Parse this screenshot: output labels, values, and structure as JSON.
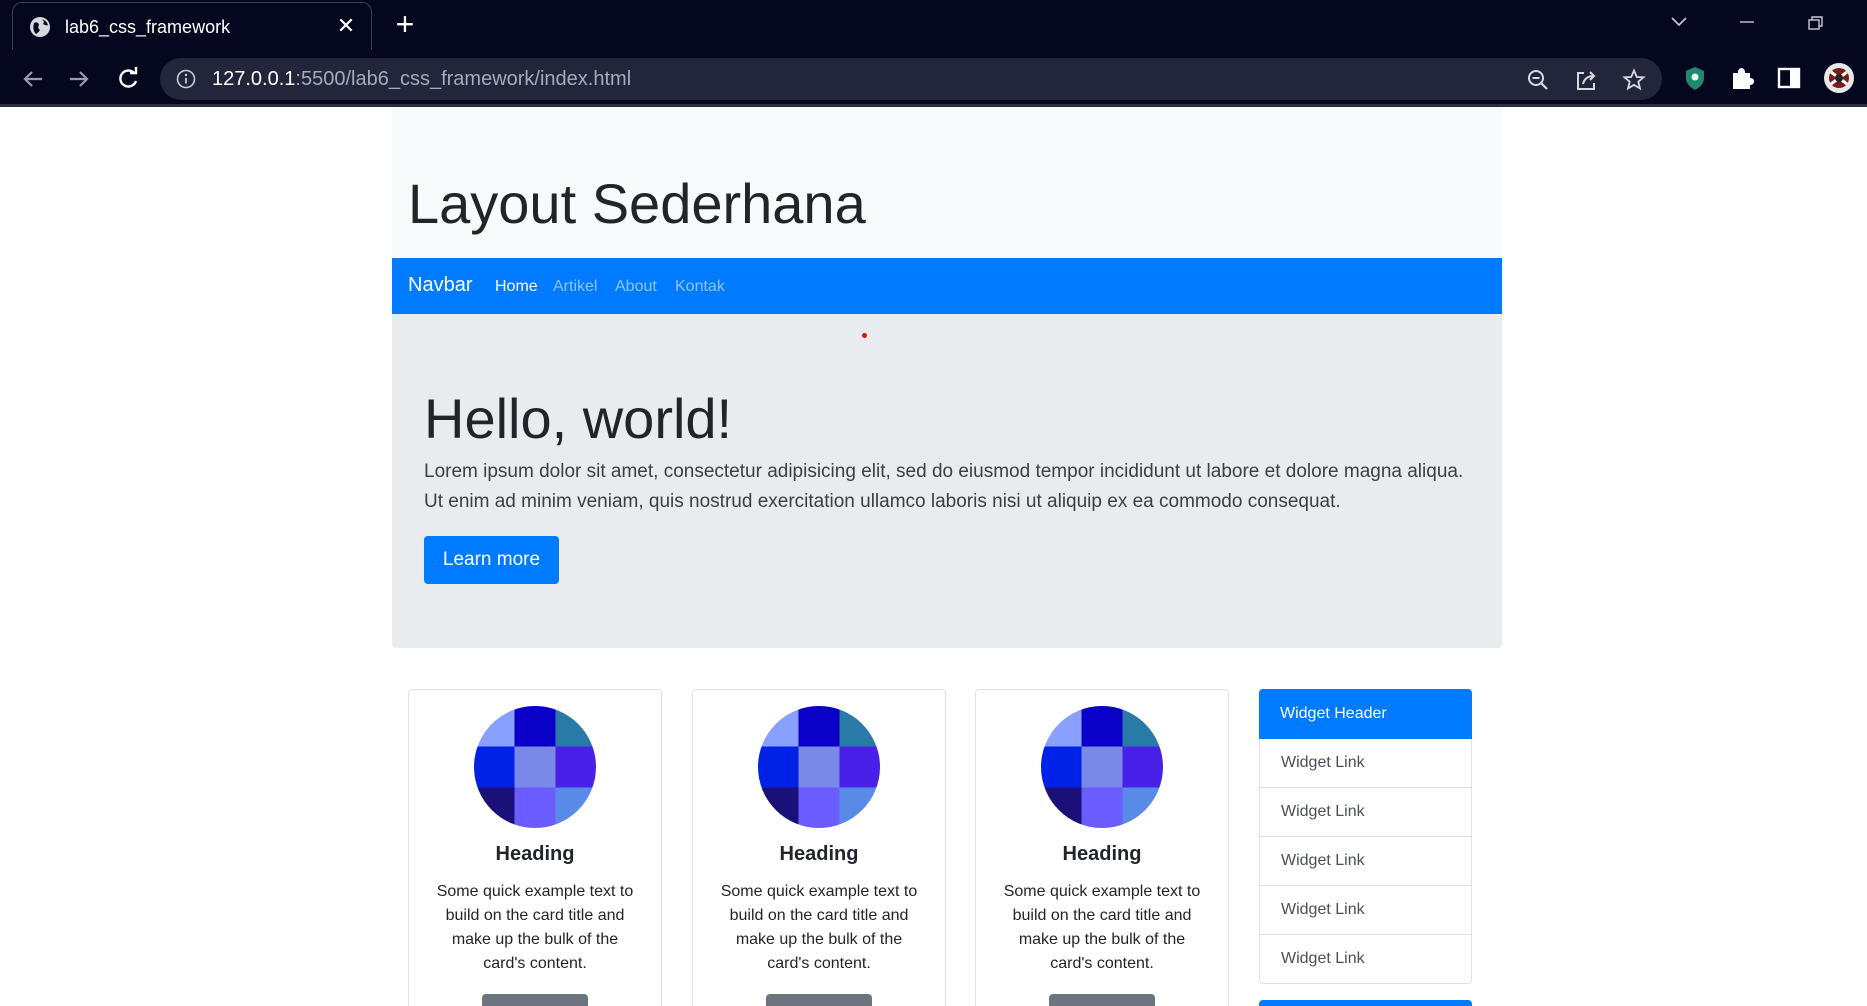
{
  "browser": {
    "tab_title": "lab6_css_framework",
    "url_host": "127.0.0.1",
    "url_rest": ":5500/lab6_css_framework/index.html"
  },
  "page": {
    "site_title": "Layout Sederhana",
    "navbar": {
      "brand": "Navbar",
      "links": [
        "Home",
        "Artikel",
        "About",
        "Kontak"
      ],
      "active": "Home"
    },
    "jumbotron": {
      "title": "Hello, world!",
      "lead": "Lorem ipsum dolor sit amet, consectetur adipisicing elit, sed do eiusmod tempor incididunt ut labore et dolore magna aliqua. Ut enim ad minim veniam, quis nostrud exercitation ullamco laboris nisi ut aliquip ex ea commodo consequat.",
      "button": "Learn more"
    },
    "cards": [
      {
        "title": "Heading",
        "text": "Some quick example text to build on the card title and make up the bulk of the card's content."
      },
      {
        "title": "Heading",
        "text": "Some quick example text to build on the card title and make up the bulk of the card's content."
      },
      {
        "title": "Heading",
        "text": "Some quick example text to build on the card title and make up the bulk of the card's content."
      }
    ],
    "widget": {
      "header": "Widget Header",
      "links": [
        "Widget Link",
        "Widget Link",
        "Widget Link",
        "Widget Link",
        "Widget Link"
      ]
    }
  },
  "colors": {
    "primary": "#007bff",
    "secondary": "#6c757d",
    "light": "#f8f9fa",
    "jumbotron": "#e9ecef",
    "chrome": "#05071f"
  },
  "icons": [
    "globe-icon",
    "close-icon",
    "plus-icon",
    "back-icon",
    "forward-icon",
    "reload-icon",
    "info-icon",
    "zoom-icon",
    "share-icon",
    "star-icon",
    "extension-shield-icon",
    "puzzle-icon",
    "sidepanel-icon",
    "profile-avatar"
  ]
}
